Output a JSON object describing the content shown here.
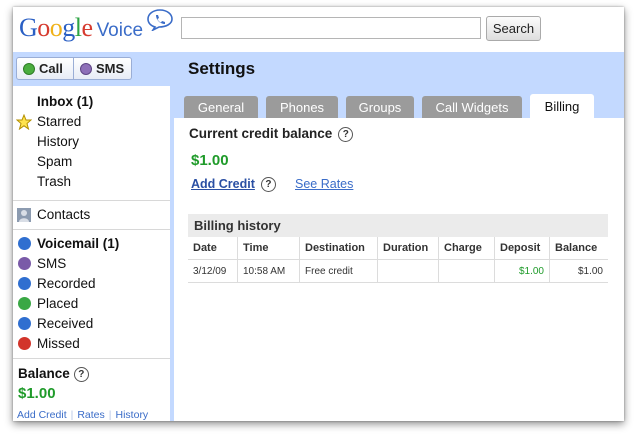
{
  "header": {
    "logo_google": [
      "G",
      "o",
      "o",
      "g",
      "l",
      "e"
    ],
    "logo_google_colors": [
      "#2a5fc4",
      "#d63b2f",
      "#f0b21a",
      "#2a5fc4",
      "#2ea445",
      "#d63b2f"
    ],
    "logo_voice": "Voice",
    "search_value": "",
    "search_button": "Search"
  },
  "sidebar": {
    "call_label": "Call",
    "sms_label": "SMS",
    "folders": [
      {
        "label": "Inbox (1)",
        "bold": true,
        "icon": "none"
      },
      {
        "label": "Starred",
        "bold": false,
        "icon": "star-icon"
      },
      {
        "label": "History",
        "bold": false,
        "icon": "none"
      },
      {
        "label": "Spam",
        "bold": false,
        "icon": "none"
      },
      {
        "label": "Trash",
        "bold": false,
        "icon": "none"
      }
    ],
    "contacts_label": "Contacts",
    "message_types": [
      {
        "label": "Voicemail (1)",
        "bold": true,
        "icon": "voicemail-icon",
        "color": "#2f6fd0"
      },
      {
        "label": "SMS",
        "bold": false,
        "icon": "sms-icon",
        "color": "#7a5aa8"
      },
      {
        "label": "Recorded",
        "bold": false,
        "icon": "recorded-icon",
        "color": "#2f6fd0"
      },
      {
        "label": "Placed",
        "bold": false,
        "icon": "placed-icon",
        "color": "#3aa845"
      },
      {
        "label": "Received",
        "bold": false,
        "icon": "received-icon",
        "color": "#2f6fd0"
      },
      {
        "label": "Missed",
        "bold": false,
        "icon": "missed-icon",
        "color": "#d2352b"
      }
    ],
    "balance_label": "Balance",
    "balance_value": "$1.00",
    "links": [
      "Add Credit",
      "Rates",
      "History"
    ]
  },
  "settings": {
    "title": "Settings",
    "tabs": [
      "General",
      "Phones",
      "Groups",
      "Call Widgets",
      "Billing"
    ],
    "active_tab": "Billing",
    "current_credit_label": "Current credit balance",
    "credit_amount": "$1.00",
    "add_credit": "Add Credit",
    "see_rates": "See Rates",
    "billing_history_title": "Billing history",
    "columns": [
      "Date",
      "Time",
      "Destination",
      "Duration",
      "Charge",
      "Deposit",
      "Balance"
    ],
    "rows": [
      [
        "3/12/09",
        "10:58 AM",
        "Free credit",
        "",
        "",
        "$1.00",
        "$1.00"
      ]
    ]
  },
  "colors": {
    "accent_blue": "#c3d9ff",
    "money_green": "#1f9b2a",
    "link_blue": "#3a6cc8"
  }
}
